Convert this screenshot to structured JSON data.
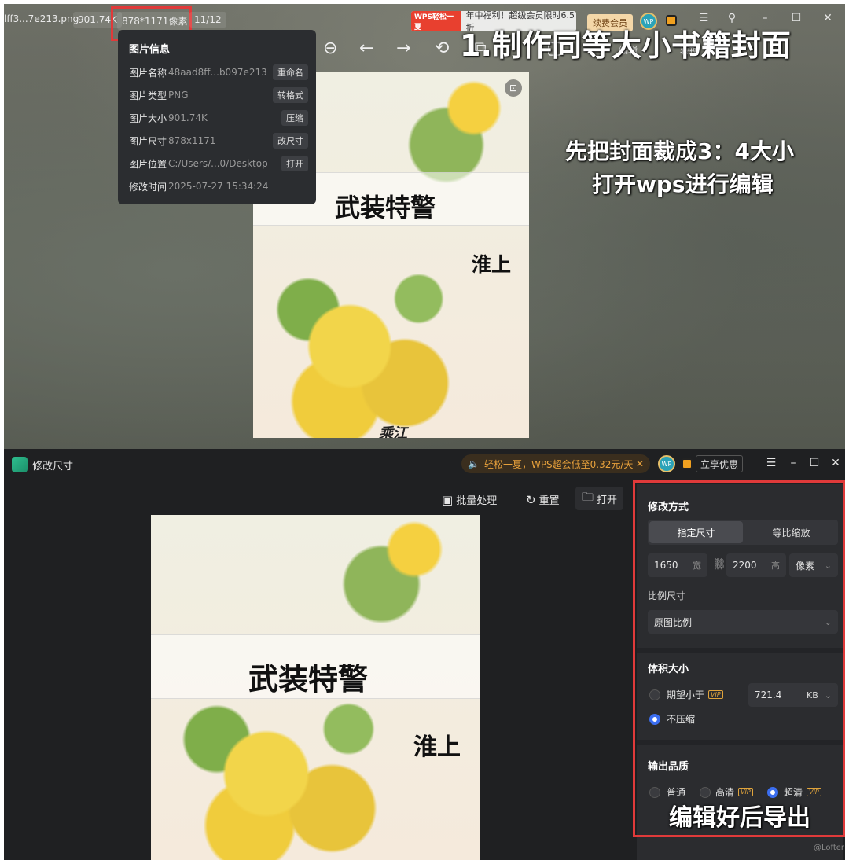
{
  "viewer": {
    "filename": "lff3...7e213.png",
    "filesize": "901.74K",
    "dimensions": "878*1171像素",
    "page_count": "11/12",
    "promo_tag": "WPS轻松一夏",
    "promo_text": "年中福利！超级会员限时6.5折",
    "vip_button": "续费会员",
    "avatar_text": "WP",
    "info_panel": {
      "title": "图片信息",
      "rows": [
        {
          "key": "图片名称",
          "value": "48aad8ff...b097e213",
          "button": "重命名"
        },
        {
          "key": "图片类型",
          "value": "PNG",
          "button": "转格式"
        },
        {
          "key": "图片大小",
          "value": "901.74K",
          "button": "压缩"
        },
        {
          "key": "图片尺寸",
          "value": "878x1171",
          "button": "改尺寸"
        },
        {
          "key": "图片位置",
          "value": "C:/Users/...0/Desktop",
          "button": "打开"
        },
        {
          "key": "修改时间",
          "value": "2025-07-27 15:34:24",
          "button": ""
        }
      ]
    },
    "toolbar_partial": "编辑",
    "toolbar_convert": "转换",
    "cover_title": "武装特警",
    "cover_author": "淮上",
    "cover_signature": "乘江"
  },
  "captions": {
    "step1": "1.制作同等大小书籍封面",
    "line1": "先把封面裁成3：4大小",
    "line2": "打开wps进行编辑",
    "export": "编辑好后导出"
  },
  "resizer": {
    "app_title": "修改尺寸",
    "notice": "轻松一夏，WPS超会低至0.32元/天",
    "avatar_text": "WP",
    "offer_button": "立享优惠",
    "batch_button": "批量处理",
    "reset_button": "重置",
    "open_button": "打开",
    "cover_title": "武装特警",
    "cover_author": "淮上",
    "settings": {
      "mode_title": "修改方式",
      "mode_options": [
        "指定尺寸",
        "等比缩放"
      ],
      "width_value": "1650",
      "width_unit": "宽",
      "height_value": "2200",
      "height_unit": "高",
      "unit_select": "像素",
      "ratio_label": "比例尺寸",
      "ratio_select": "原图比例",
      "size_title": "体积大小",
      "expect_label": "期望小于",
      "expect_value": "721.4",
      "expect_unit": "KB",
      "no_compress": "不压缩",
      "quality_title": "输出品质",
      "quality_options": [
        "普通",
        "高清",
        "超清"
      ],
      "vip_tag": "VIP"
    },
    "watermark": "@Lofter"
  }
}
